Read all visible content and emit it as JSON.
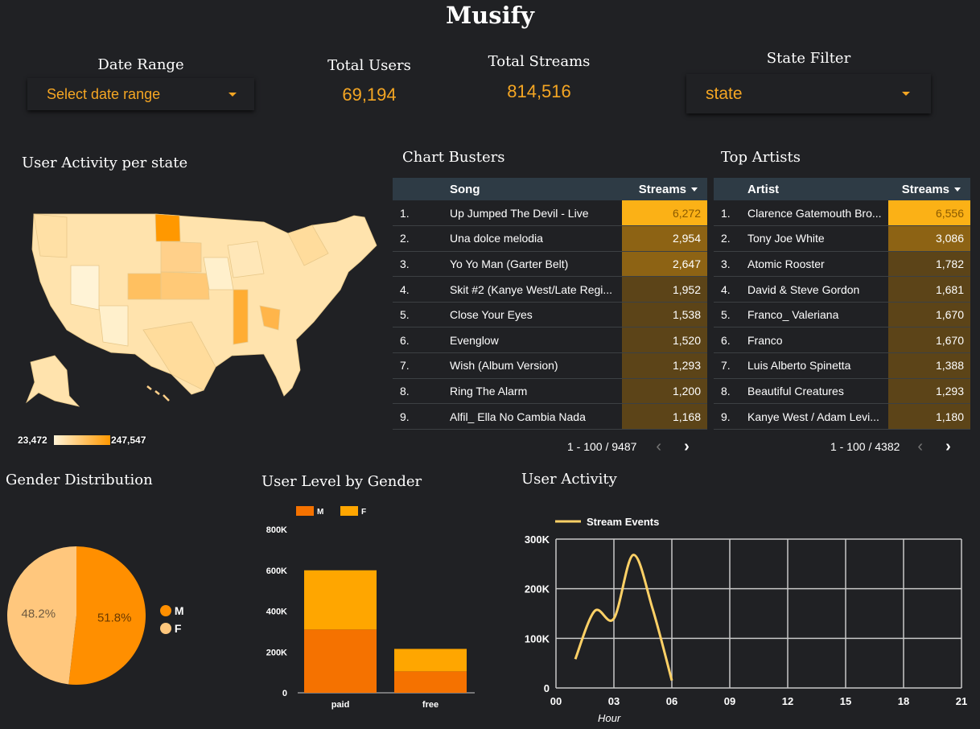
{
  "header": {
    "title": "Musify"
  },
  "controls": {
    "date_range": {
      "label": "Date Range",
      "value": "Select date range"
    },
    "total_users": {
      "label": "Total Users",
      "value": "69,194"
    },
    "total_streams": {
      "label": "Total Streams",
      "value": "814,516"
    },
    "state_filter": {
      "label": "State Filter",
      "value": "state"
    }
  },
  "map": {
    "title": "User Activity per state",
    "legend_min": "23,472",
    "legend_max": "247,547",
    "colors": {
      "low": "#fff3d6",
      "high": "#ff9800"
    }
  },
  "chart_busters": {
    "title": "Chart Busters",
    "col_song": "Song",
    "col_streams": "Streams",
    "rows": [
      {
        "rank": "1.",
        "name": "Up Jumped The Devil - Live",
        "value": "6,272",
        "num": 6272
      },
      {
        "rank": "2.",
        "name": "Una dolce melodia",
        "value": "2,954",
        "num": 2954
      },
      {
        "rank": "3.",
        "name": "Yo Yo Man (Garter Belt)",
        "value": "2,647",
        "num": 2647
      },
      {
        "rank": "4.",
        "name": "Skit #2 (Kanye West/Late Regi...",
        "value": "1,952",
        "num": 1952
      },
      {
        "rank": "5.",
        "name": "Close Your Eyes",
        "value": "1,538",
        "num": 1538
      },
      {
        "rank": "6.",
        "name": "Evenglow",
        "value": "1,520",
        "num": 1520
      },
      {
        "rank": "7.",
        "name": "Wish (Album Version)",
        "value": "1,293",
        "num": 1293
      },
      {
        "rank": "8.",
        "name": "Ring The Alarm",
        "value": "1,200",
        "num": 1200
      },
      {
        "rank": "9.",
        "name": "Alfil_ Ella No Cambia Nada",
        "value": "1,168",
        "num": 1168
      }
    ],
    "pager": "1 - 100 / 9487"
  },
  "top_artists": {
    "title": "Top Artists",
    "col_artist": "Artist",
    "col_streams": "Streams",
    "rows": [
      {
        "rank": "1.",
        "name": "Clarence Gatemouth Bro...",
        "value": "6,556",
        "num": 6556
      },
      {
        "rank": "2.",
        "name": "Tony Joe White",
        "value": "3,086",
        "num": 3086
      },
      {
        "rank": "3.",
        "name": "Atomic Rooster",
        "value": "1,782",
        "num": 1782
      },
      {
        "rank": "4.",
        "name": "David & Steve Gordon",
        "value": "1,681",
        "num": 1681
      },
      {
        "rank": "5.",
        "name": "Franco_ Valeriana",
        "value": "1,670",
        "num": 1670
      },
      {
        "rank": "6.",
        "name": "Franco",
        "value": "1,670",
        "num": 1670
      },
      {
        "rank": "7.",
        "name": "Luis Alberto Spinetta",
        "value": "1,388",
        "num": 1388
      },
      {
        "rank": "8.",
        "name": "Beautiful Creatures",
        "value": "1,293",
        "num": 1293
      },
      {
        "rank": "9.",
        "name": "Kanye West / Adam Levi...",
        "value": "1,180",
        "num": 1180
      }
    ],
    "pager": "1 - 100 / 4382"
  },
  "gender": {
    "title": "Gender Distribution",
    "legend": [
      "M",
      "F"
    ],
    "colors": {
      "M": "#ff8f00",
      "F": "#ffc77d"
    }
  },
  "user_level": {
    "title": "User Level by Gender",
    "colors": {
      "M": "#f57200",
      "F": "#ffa600"
    }
  },
  "activity": {
    "title": "User Activity",
    "series_label": "Stream Events",
    "xlabel": "Hour",
    "color": "#ffd166"
  },
  "chart_data": [
    {
      "type": "pie",
      "labels": [
        "M",
        "F"
      ],
      "values": [
        51.8,
        48.2
      ],
      "value_labels": [
        "51.8%",
        "48.2%"
      ]
    },
    {
      "type": "bar",
      "stacked": true,
      "categories": [
        "paid",
        "free"
      ],
      "series": [
        {
          "name": "M",
          "values": [
            310000,
            105000
          ]
        },
        {
          "name": "F",
          "values": [
            290000,
            110000
          ]
        }
      ],
      "ylim": [
        0,
        800000
      ],
      "yticks": [
        "0",
        "200K",
        "400K",
        "600K",
        "800K"
      ],
      "legend": "top-left"
    },
    {
      "type": "line",
      "series": [
        {
          "name": "Stream Events",
          "x": [
            1,
            2,
            3,
            4,
            5,
            6
          ],
          "y": [
            58000,
            155000,
            140000,
            268000,
            160000,
            15000
          ]
        }
      ],
      "xlim": [
        0,
        21
      ],
      "ylim": [
        0,
        300000
      ],
      "xticks": [
        "00",
        "03",
        "06",
        "09",
        "12",
        "15",
        "18",
        "21"
      ],
      "yticks": [
        "0",
        "100K",
        "200K",
        "300K"
      ],
      "xlabel": "Hour",
      "grid": true,
      "legend": "top-left"
    }
  ]
}
